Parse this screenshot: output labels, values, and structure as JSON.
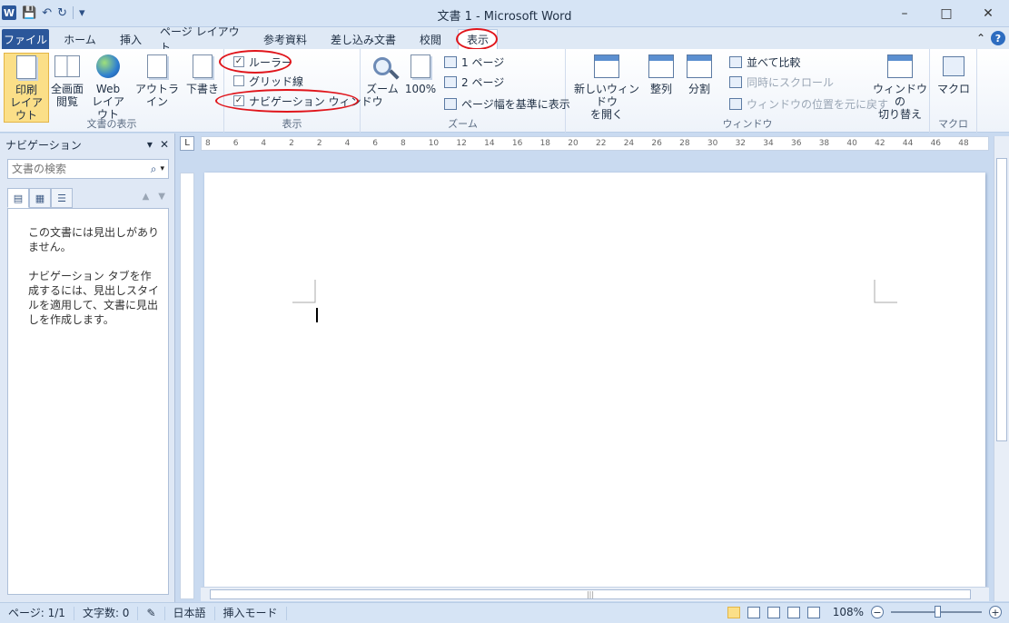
{
  "app": {
    "title": "文書 1 - Microsoft Word"
  },
  "qat": {
    "icons": [
      "word-logo",
      "save-icon",
      "undo-icon",
      "redo-icon",
      "customize-icon"
    ],
    "logo_letter": "W"
  },
  "window_controls": {
    "minimize": "–",
    "maximize": "□",
    "close": "✕"
  },
  "tabs": [
    {
      "label": "ファイル"
    },
    {
      "label": "ホーム"
    },
    {
      "label": "挿入"
    },
    {
      "label": "ページ レイアウト"
    },
    {
      "label": "参考資料"
    },
    {
      "label": "差し込み文書"
    },
    {
      "label": "校閲"
    },
    {
      "label": "表示"
    }
  ],
  "ribbon": {
    "doc_views": {
      "group_label": "文書の表示",
      "print_layout": "印刷\nレイアウト",
      "full_screen": "全画面\n閲覧",
      "web_layout": "Web\nレイアウト",
      "outline": "アウトライン",
      "draft": "下書き"
    },
    "show": {
      "group_label": "表示",
      "ruler": "ルーラー",
      "gridlines": "グリッド線",
      "nav_pane": "ナビゲーション ウィンドウ",
      "ruler_checked": true,
      "gridlines_checked": false,
      "nav_pane_checked": true
    },
    "zoom": {
      "group_label": "ズーム",
      "zoom": "ズーム",
      "hundred": "100%",
      "one_page": "1 ページ",
      "two_pages": "2 ページ",
      "page_width": "ページ幅を基準に表示"
    },
    "window": {
      "group_label": "ウィンドウ",
      "new_window": "新しいウィンドウ\nを開く",
      "arrange_all": "整列",
      "split": "分割",
      "side_by_side": "並べて比較",
      "sync_scroll": "同時にスクロール",
      "reset_position": "ウィンドウの位置を元に戻す",
      "switch_windows": "ウィンドウの\n切り替え"
    },
    "macros": {
      "group_label": "マクロ",
      "macros": "マクロ"
    }
  },
  "nav": {
    "title": "ナビゲーション",
    "search_placeholder": "文書の検索",
    "message1": "この文書には見出しがありません。",
    "message2": "ナビゲーション タブを作成するには、見出しスタイルを適用して、文書に見出しを作成します。"
  },
  "ruler": {
    "corner": "L",
    "ticks": [
      "8",
      "6",
      "4",
      "2",
      "2",
      "4",
      "6",
      "8",
      "10",
      "12",
      "14",
      "16",
      "18",
      "20",
      "22",
      "24",
      "26",
      "28",
      "30",
      "32",
      "34",
      "36",
      "38",
      "40",
      "42",
      "44",
      "46",
      "48"
    ]
  },
  "statusbar": {
    "page": "ページ: 1/1",
    "words": "文字数: 0",
    "language": "日本語",
    "mode": "挿入モード",
    "zoom": "108%",
    "zoom_level_percent": 108
  },
  "colors": {
    "accent": "#2b579a",
    "highlight_ring": "#e0151b",
    "selected_button": "#fbdf88"
  }
}
